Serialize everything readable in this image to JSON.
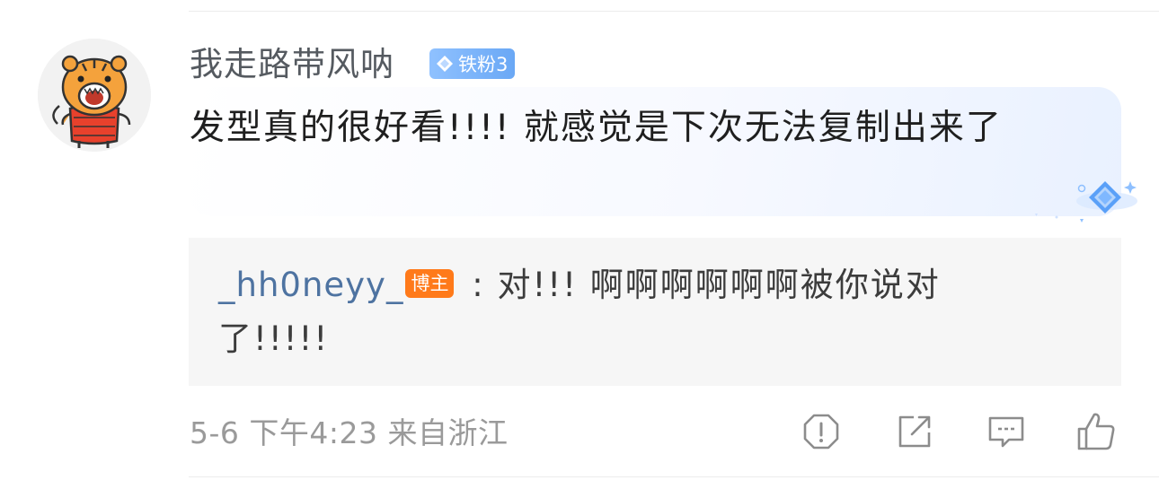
{
  "comment": {
    "username": "我走路带风呐",
    "fan_badge": {
      "label": "铁粉3",
      "icon": "diamond-icon",
      "color": "#7ab3fa"
    },
    "text": "发型真的很好看!!!! 就感觉是下次无法复制出来了"
  },
  "reply": {
    "author": "_hh0neyy_",
    "author_badge": "博主",
    "separator": " : ",
    "text": "对!!! 啊啊啊啊啊啊被你说对了!!!!!",
    "author_color": "#4e73a1",
    "badge_color": "#ff7a1a"
  },
  "meta": {
    "date": "5-6",
    "time": "下午4:23",
    "location": "来自浙江"
  },
  "actions": {
    "icons": [
      "report-icon",
      "share-icon",
      "comment-icon",
      "like-icon"
    ]
  }
}
